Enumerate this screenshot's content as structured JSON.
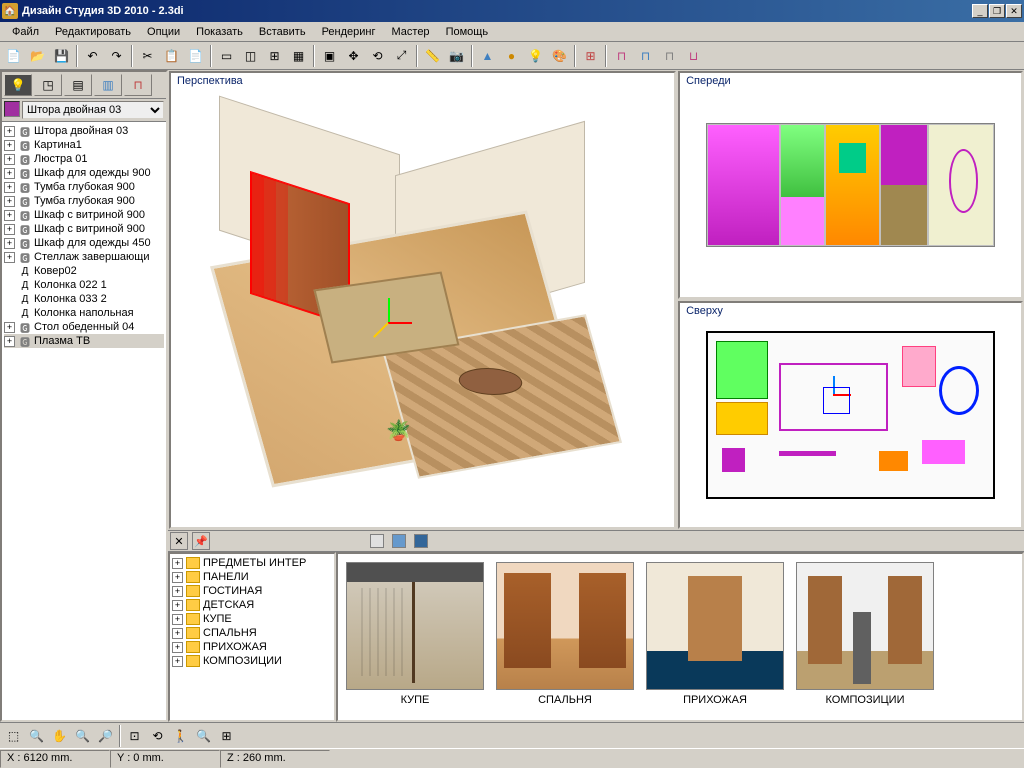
{
  "titlebar": {
    "title": "Дизайн Студия 3D 2010 - 2.3di"
  },
  "menu": {
    "file": "Файл",
    "edit": "Редактировать",
    "options": "Опции",
    "show": "Показать",
    "insert": "Вставить",
    "render": "Рендеринг",
    "wizard": "Мастер",
    "help": "Помощь"
  },
  "viewports": {
    "perspective": "Перспектива",
    "front": "Спереди",
    "top": "Сверху"
  },
  "object_selector": {
    "selected": "Штора двойная 03"
  },
  "scene_tree": [
    {
      "label": "Штора двойная 03",
      "expandable": true,
      "icon": "group"
    },
    {
      "label": "Картина1",
      "expandable": true,
      "icon": "group"
    },
    {
      "label": "Люстра 01",
      "expandable": true,
      "icon": "group"
    },
    {
      "label": "Шкаф для одежды 900",
      "expandable": true,
      "icon": "group"
    },
    {
      "label": "Тумба глубокая 900",
      "expandable": true,
      "icon": "group"
    },
    {
      "label": "Тумба глубокая 900",
      "expandable": true,
      "icon": "group"
    },
    {
      "label": "Шкаф с витриной 900",
      "expandable": true,
      "icon": "group"
    },
    {
      "label": "Шкаф с витриной 900",
      "expandable": true,
      "icon": "group"
    },
    {
      "label": "Шкаф для одежды 450",
      "expandable": true,
      "icon": "group"
    },
    {
      "label": "Стеллаж завершающи",
      "expandable": true,
      "icon": "group"
    },
    {
      "label": "Ковер02",
      "expandable": false,
      "icon": "detail"
    },
    {
      "label": "Колонка 022 1",
      "expandable": false,
      "icon": "detail"
    },
    {
      "label": "Колонка 033 2",
      "expandable": false,
      "icon": "detail"
    },
    {
      "label": "Колонка напольная",
      "expandable": false,
      "icon": "detail"
    },
    {
      "label": "Стол обеденный 04",
      "expandable": true,
      "icon": "group"
    },
    {
      "label": "Плазма ТВ",
      "expandable": true,
      "icon": "group",
      "selected": true
    }
  ],
  "library_tree": [
    {
      "label": "ПРЕДМЕТЫ ИНТЕР"
    },
    {
      "label": "ПАНЕЛИ"
    },
    {
      "label": "ГОСТИНАЯ"
    },
    {
      "label": "ДЕТСКАЯ"
    },
    {
      "label": "КУПЕ"
    },
    {
      "label": "СПАЛЬНЯ"
    },
    {
      "label": "ПРИХОЖАЯ"
    },
    {
      "label": "КОМПОЗИЦИИ"
    }
  ],
  "library_items": [
    {
      "label": "КУПЕ",
      "thumb": "kupe"
    },
    {
      "label": "СПАЛЬНЯ",
      "thumb": "spal"
    },
    {
      "label": "ПРИХОЖАЯ",
      "thumb": "prih"
    },
    {
      "label": "КОМПОЗИЦИИ",
      "thumb": "komp"
    }
  ],
  "status": {
    "x": "X : 6120 mm.",
    "y": "Y : 0 mm.",
    "z": "Z : 260 mm."
  }
}
